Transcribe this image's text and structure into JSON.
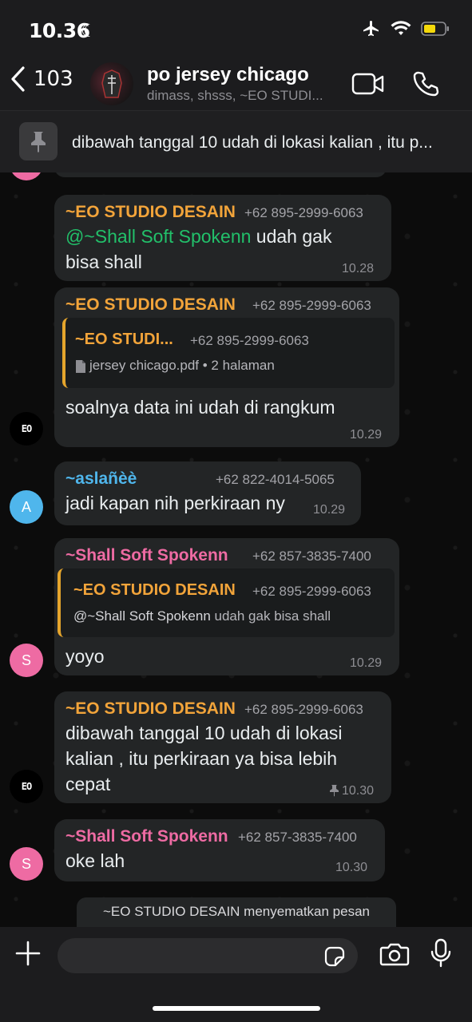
{
  "status_bar": {
    "time": "10.36",
    "icons": [
      "moon-icon",
      "airplane-icon",
      "wifi-icon",
      "battery-icon"
    ]
  },
  "header": {
    "back_count": "103",
    "title": "po jersey chicago",
    "subtitle": "dimass, shsss, ~EO STUDI..."
  },
  "pinned": {
    "text": "dibawah tanggal 10 udah di lokasi kalian , itu p..."
  },
  "messages": {
    "m1": {
      "sender": "~EO STUDIO DESAIN",
      "phone": "+62 895-2999-6063",
      "mention": "@~Shall Soft Spokenn",
      "line1": " udah gak",
      "line2": "bisa shall",
      "time": "10.28"
    },
    "m2": {
      "sender": "~EO STUDIO DESAIN",
      "phone": "+62 895-2999-6063",
      "quote_sender": "~EO STUDI...",
      "quote_phone": "+62 895-2999-6063",
      "quote_text": "jersey chicago.pdf • 2 halaman",
      "text": "soalnya data ini udah di rangkum",
      "time": "10.29",
      "avatar_text": "EO"
    },
    "m3": {
      "sender": "~aslañèè",
      "phone": "+62 822-4014-5065",
      "text": "jadi kapan nih perkiraan ny",
      "time": "10.29",
      "avatar_letter": "A"
    },
    "m4": {
      "sender": "~Shall Soft Spokenn",
      "phone": "+62 857-3835-7400",
      "quote_sender": "~EO STUDIO DESAIN",
      "quote_phone": "+62 895-2999-6063",
      "quote_mention": "@~Shall Soft Spokenn",
      "quote_text": " udah gak bisa shall",
      "text": "yoyo",
      "time": "10.29",
      "avatar_letter": "S"
    },
    "m5": {
      "sender": "~EO STUDIO DESAIN",
      "phone": "+62 895-2999-6063",
      "line1": "dibawah tanggal 10 udah di lokasi",
      "line2": "kalian , itu perkiraan ya bisa lebih",
      "line3": "cepat",
      "time": "10.30",
      "avatar_text": "EO"
    },
    "m6": {
      "sender": "~Shall Soft Spokenn",
      "phone": "+62 857-3835-7400",
      "text": "oke lah",
      "time": "10.30",
      "avatar_letter": "S"
    }
  },
  "system_message": "~EO STUDIO DESAIN menyematkan pesan",
  "colors": {
    "orange": "#f2a43a",
    "blue": "#4fb6ec",
    "pink": "#ee6ba3",
    "green": "#22c06a",
    "bubble": "#232526"
  }
}
